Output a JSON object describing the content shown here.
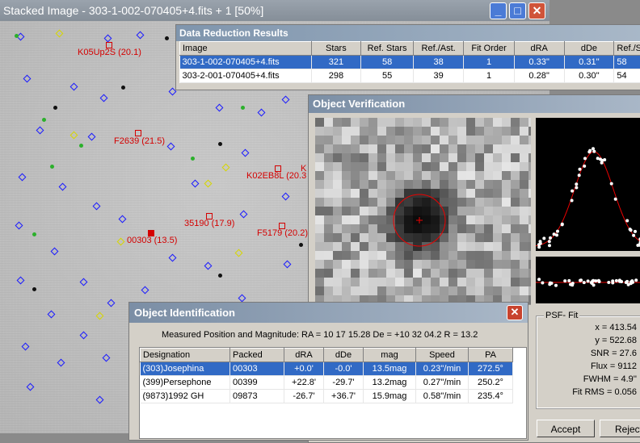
{
  "stacked_window": {
    "title": "Stacked Image - 303-1-002-070405+4.fits + 1 [50%]",
    "minimize": "_",
    "maximize": "□",
    "close": "✕"
  },
  "field_labels": [
    "K05Up2S (20.1)",
    "F2639 (21.5)",
    "K02EB8L (20.3",
    "35190 (17.9)",
    "F5179 (20.2)",
    "00303 (13.5)",
    "K"
  ],
  "data_reduction": {
    "title": "Data Reduction Results",
    "columns": [
      "Image",
      "Stars",
      "Ref. Stars",
      "Ref./Ast.",
      "Fit Order",
      "dRA",
      "dDe",
      "Ref./S"
    ],
    "rows": [
      [
        "303-1-002-070405+4.fits",
        "321",
        "58",
        "38",
        "1",
        "0.33''",
        "0.31''",
        "58"
      ],
      [
        "303-2-001-070405+4.fits",
        "298",
        "55",
        "39",
        "1",
        "0.28''",
        "0.30''",
        "54"
      ]
    ]
  },
  "object_verification": {
    "title": "Object Verification",
    "psf_fit": {
      "legend": "PSF- Fit",
      "rows": [
        "x = 413.54",
        "y = 522.68",
        "SNR = 27.6",
        "Flux = 9112",
        "FWHM = 4.9''",
        "Fit RMS = 0.056"
      ]
    },
    "accept_label": "Accept",
    "reject_label": "Reject"
  },
  "object_identification": {
    "title": "Object Identification",
    "close": "✕",
    "measured": "Measured Position and Magnitude:  RA = 10 17 15.28   De = +10 32 04.2   R = 13.2",
    "columns": [
      "Designation",
      "Packed",
      "dRA",
      "dDe",
      "mag",
      "Speed",
      "PA"
    ],
    "rows": [
      [
        "(303)Josephina",
        "00303",
        "+0.0'",
        "-0.0'",
        "13.5mag",
        "0.23''/min",
        "272.5°"
      ],
      [
        "(399)Persephone",
        "00399",
        "+22.8'",
        "-29.7'",
        "13.2mag",
        "0.27''/min",
        "250.2°"
      ],
      [
        "(9873)1992 GH",
        "09873",
        "-26.7'",
        "+36.7'",
        "15.9mag",
        "0.58''/min",
        "235.4°"
      ]
    ]
  }
}
